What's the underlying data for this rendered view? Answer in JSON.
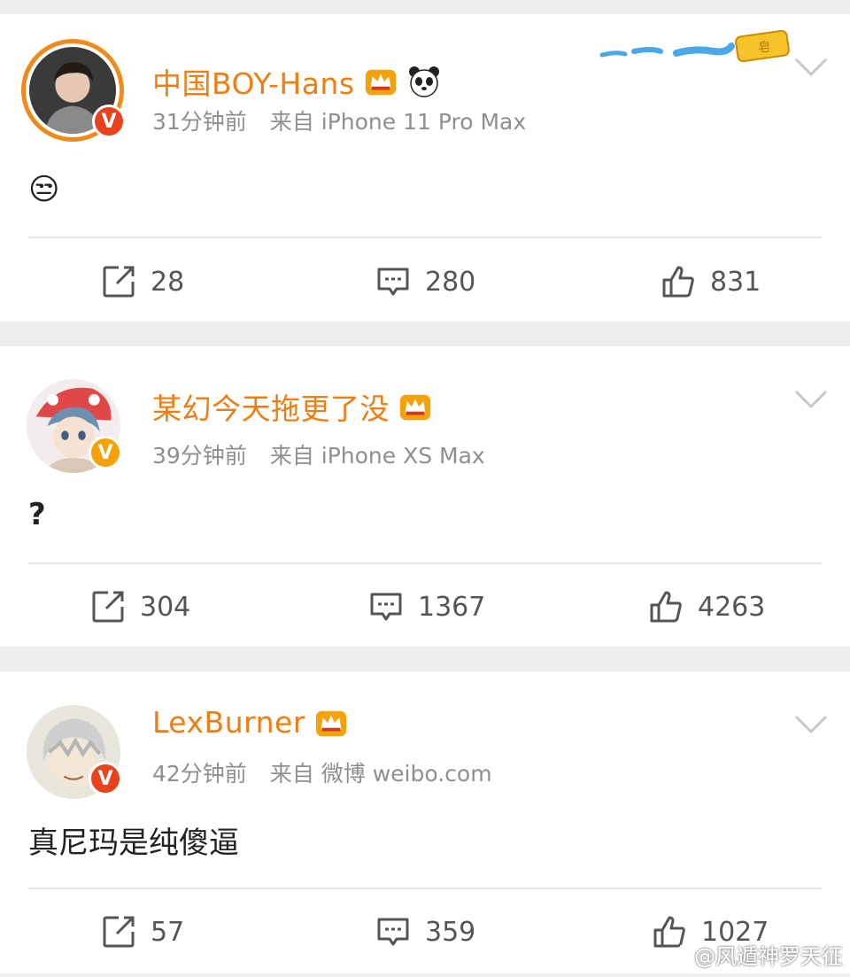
{
  "posts": [
    {
      "username": "中国BOY-Hans",
      "time": "31分钟前",
      "source": "来自 iPhone 11 Pro Max",
      "content": "😒",
      "reposts": "28",
      "comments": "280",
      "likes": "831",
      "badge_color": "#e8421f"
    },
    {
      "username": "某幻今天拖更了没",
      "time": "39分钟前",
      "source": "来自 iPhone XS Max",
      "content": "?",
      "reposts": "304",
      "comments": "1367",
      "likes": "4263",
      "badge_color": "#f4a10a"
    },
    {
      "username": "LexBurner",
      "time": "42分钟前",
      "source": "来自 微博 weibo.com",
      "content": "真尼玛是纯傻逼",
      "reposts": "57",
      "comments": "359",
      "likes": "1027",
      "badge_color": "#e8421f"
    }
  ],
  "watermark": "@风遁神罗天征",
  "colors": {
    "name": "#f07d12",
    "meta": "#8f8f8f",
    "crown": "#f4a10a"
  },
  "icons": [
    "repost-icon",
    "comment-icon",
    "like-icon",
    "chevron-down-icon",
    "crown-icon",
    "panda-icon",
    "verified-badge-icon",
    "weibo-logo-icon"
  ]
}
